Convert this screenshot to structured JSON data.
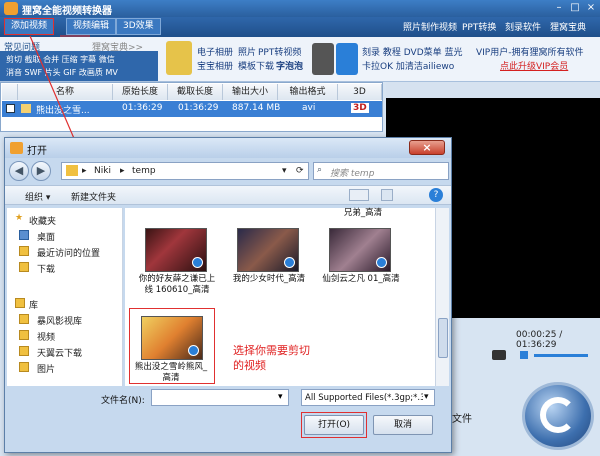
{
  "app": {
    "title": "狸窝全能视频转换器",
    "tabs": [
      "添加视频",
      "视频编辑",
      "3D效果"
    ],
    "top_links": [
      "照片制作视频",
      "PPT转换",
      "刻录软件",
      "狸窝宝典"
    ]
  },
  "promo": {
    "faq_heading": "常见问题",
    "faq_site": "狸窝宝典>>",
    "faq_links_row1": "剪切 截取 合并 压缩 字幕 微信",
    "faq_links_row2": "消音 SWF 片头 GIF 改画质 MV",
    "links_a": [
      "电子相册",
      "照片",
      "PPT转视频"
    ],
    "links_b": [
      "宝宝相册",
      "模板下载",
      "字泡泡"
    ],
    "links_c": [
      "刻录",
      "教程",
      "DVD菜单",
      "蓝光"
    ],
    "links_d": [
      "卡拉OK",
      "加清洁ailiewo"
    ],
    "vip_text": "VIP用户-拥有狸窝所有软件",
    "vip_link": "点此升级VIP会员"
  },
  "file_table": {
    "headers": [
      "名称",
      "原始长度",
      "截取长度",
      "输出大小",
      "输出格式",
      "3D"
    ],
    "rows": [
      {
        "name": "熊出没之雪...",
        "original": "01:36:29",
        "clipped": "01:36:29",
        "size": "887.14 MB",
        "format": "avi",
        "threed": "3D"
      }
    ]
  },
  "preview": {
    "time": "00:00:25 / 01:36:29"
  },
  "main_side_text": "文件",
  "dialog": {
    "title": "打开",
    "path": [
      "Niki",
      "temp"
    ],
    "search_placeholder": "搜索 temp",
    "organize": "组织 ▾",
    "new_folder": "新建文件夹",
    "nav": {
      "favorites": "收藏夹",
      "items": [
        "桌面",
        "最近访问的位置",
        "下载"
      ],
      "library": "库",
      "lib_items": [
        "暴风影视库",
        "视频",
        "天翼云下载",
        "图片"
      ]
    },
    "files": [
      {
        "caption": "兄弟_高清"
      },
      {
        "caption": "你的好友薛之谦已上线 160610_高清"
      },
      {
        "caption": "我的少女时代_高清"
      },
      {
        "caption": "仙剑云之凡 01_高清"
      },
      {
        "caption": "熊出没之雪岭熊风_高清"
      }
    ],
    "annotation": "选择你需要剪切的视频",
    "filename_label": "文件名(N):",
    "filename_value": "",
    "filetype": "All Supported Files(*.3gp;*.3",
    "open_button": "打开(O)",
    "cancel_button": "取消"
  }
}
